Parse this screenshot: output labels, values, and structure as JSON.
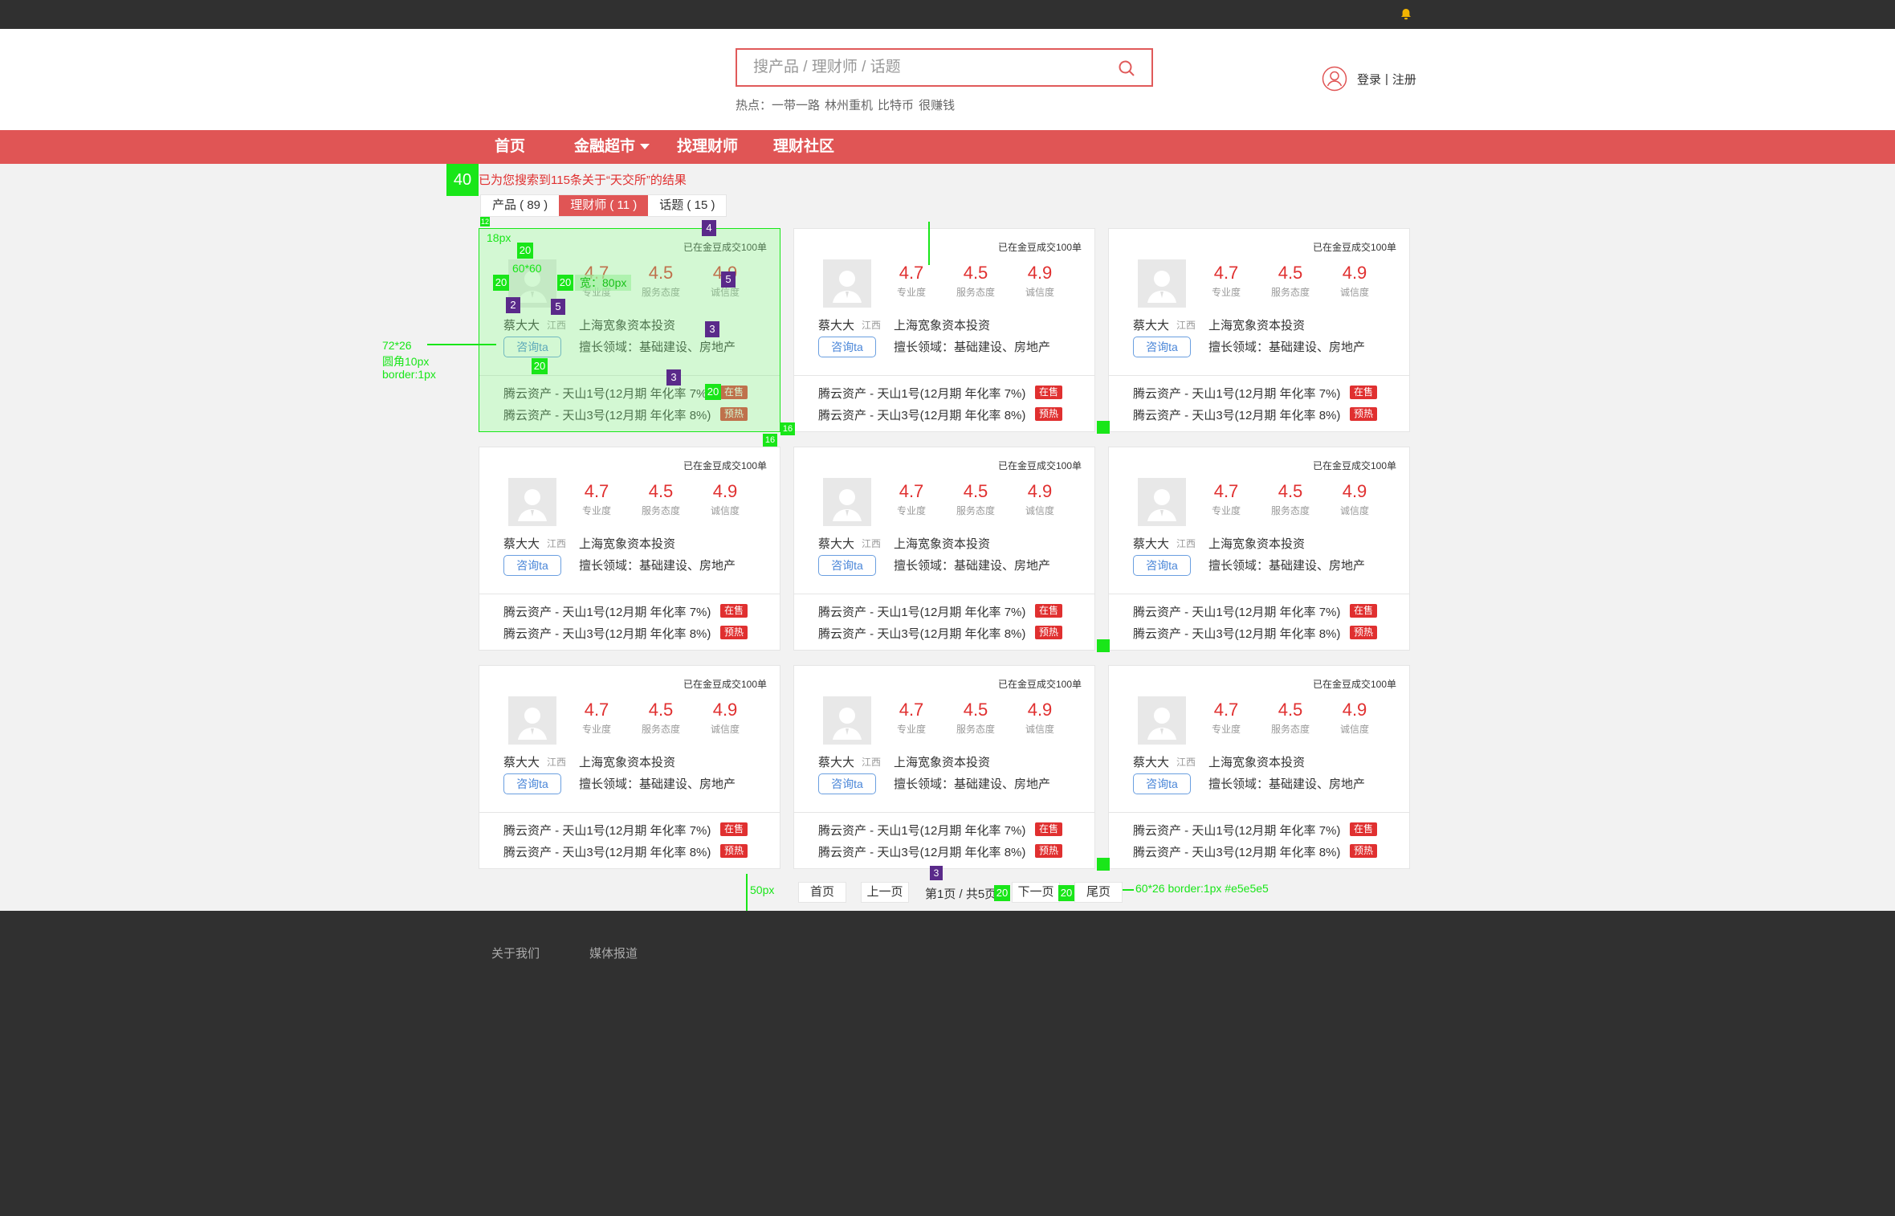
{
  "header": {
    "search_placeholder": "搜产品 / 理财师 / 话题",
    "hot_label": "热点：",
    "hot_items": [
      "一带一路",
      "林州重机",
      "比特币",
      "很赚钱"
    ],
    "login": "登录",
    "sep": "|",
    "register": "注册"
  },
  "nav": {
    "home": "首页",
    "market": "金融超市",
    "planner": "找理财师",
    "community": "理财社区"
  },
  "result": {
    "text": "已为您搜索到115条关于“天交所”的结果"
  },
  "tabs": [
    {
      "label": "产品 ( 89 )"
    },
    {
      "label": "理财师 ( 11 )"
    },
    {
      "label": "话题 ( 15 )"
    }
  ],
  "card": {
    "deals": "已在金豆成交100单",
    "scores": [
      {
        "num": "4.7",
        "label": "专业度"
      },
      {
        "num": "4.5",
        "label": "服务态度"
      },
      {
        "num": "4.9",
        "label": "诚信度"
      }
    ],
    "name": "蔡大大",
    "region": "江西",
    "company": "上海宽象资本投资",
    "consult": "咨询ta",
    "field": "擅长领域：基础建设、房地产",
    "product1": "腾云资产 - 天山1号(12月期 年化率 7%)",
    "product2": "腾云资产 - 天山3号(12月期 年化率 8%)",
    "badge1": "在售",
    "badge2": "预热"
  },
  "pager": {
    "first": "首页",
    "prev": "上一页",
    "status": "第1页 / 共5页",
    "next": "下一页",
    "last": "尾页"
  },
  "footer": {
    "about": "关于我们",
    "media": "媒体报道"
  },
  "annotations": {
    "n40": "40",
    "n20": "20",
    "n16": "16",
    "n12": "12",
    "n5": "5",
    "n4": "4",
    "n3": "3",
    "n2": "2",
    "px18": "18px",
    "size60": "60*60",
    "width80": "宽：80px",
    "btn_spec1": "72*26",
    "btn_spec2": "圆角10px",
    "btn_spec3": "border:1px",
    "px50": "50px",
    "pager_spec": "60*26 border:1px #e5e5e5"
  },
  "colors": {
    "accent": "#e05555",
    "price_red": "#e03030",
    "link_blue": "#4a86d8",
    "annotation_green": "#19e619",
    "annotation_purple": "#5a2a8a",
    "dark": "#303030"
  }
}
